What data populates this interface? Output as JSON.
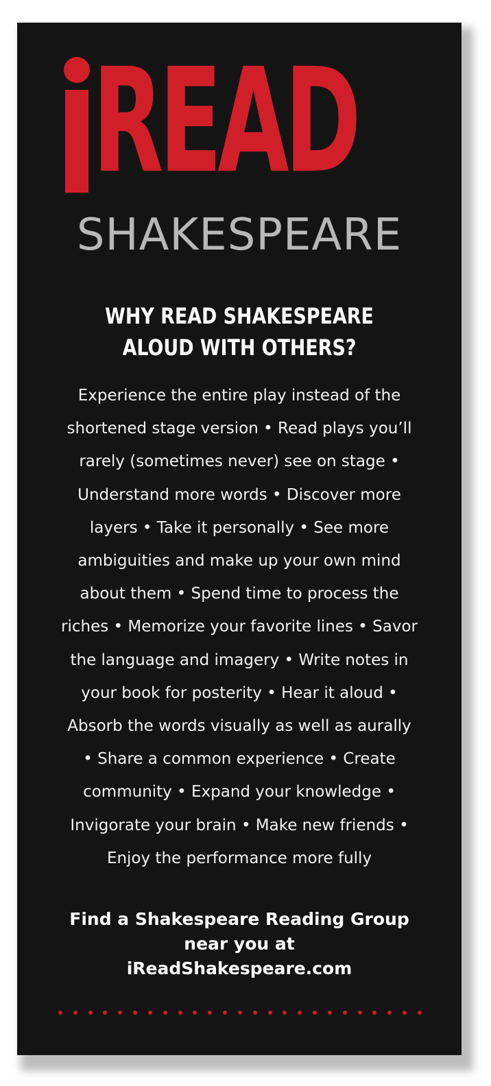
{
  "logo": {
    "word": "READ",
    "subtitle": "SHAKESPEARE"
  },
  "heading": {
    "lines": [
      "WHY READ SHAKESPEARE",
      "ALOUD WITH OTHERS?"
    ]
  },
  "body": {
    "lines": [
      "Experience the entire play instead of the",
      "shortened stage version • Read plays you’ll",
      "rarely (sometimes never) see on stage •",
      "Understand more words • Discover more",
      "layers • Take it personally • See more",
      "ambiguities and make up your own mind",
      "about them • Spend time to process the",
      "riches • Memorize your favorite lines • Savor",
      "the language and imagery • Write notes in",
      "your book for posterity • Hear it aloud •",
      "Absorb the words visually as well as aurally",
      "• Share a common experience • Create",
      "community • Expand your knowledge •",
      "Invigorate your brain • Make new friends •",
      "Enjoy the performance more fully"
    ]
  },
  "cta": {
    "lines": [
      "Find a Shakespeare Reading Group",
      "near you at",
      "iReadShakespeare.com"
    ]
  },
  "colors": {
    "background": "#141414",
    "accent_red": "#d11f2a",
    "subtitle_gray": "#b8b8b8",
    "text": "#ffffff"
  }
}
